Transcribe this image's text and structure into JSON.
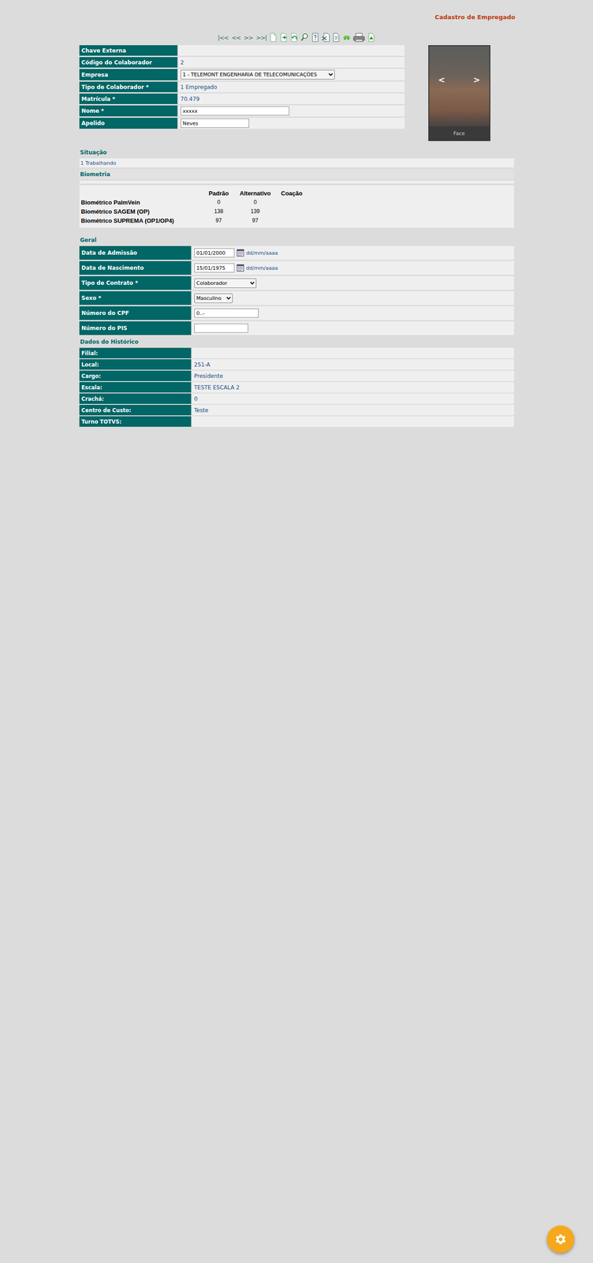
{
  "header": {
    "title": "Cadastro de Empregado"
  },
  "toolbar": {
    "nav": [
      "|<<",
      "<<",
      ">>",
      ">>|"
    ]
  },
  "identity": {
    "fields": [
      {
        "label": "Chave Externa",
        "kind": "text",
        "value": ""
      },
      {
        "label": "Código do Colaborador",
        "kind": "text",
        "value": "2"
      },
      {
        "label": "Empresa",
        "kind": "select",
        "value": "1 - TELEMONT ENGENHARIA DE TELECOMUNICAÇÕES"
      },
      {
        "label": "Tipo de Colaborador *",
        "kind": "text",
        "value": "1 Empregado"
      },
      {
        "label": "Matrícula *",
        "kind": "text",
        "value": "70.479"
      },
      {
        "label": "Nome *",
        "kind": "input",
        "value": "xxxxx"
      },
      {
        "label": "Apelido",
        "kind": "input",
        "value": "Neves"
      }
    ]
  },
  "photo": {
    "prev": "<",
    "next": ">",
    "caption": "Face"
  },
  "situacao": {
    "title": "Situação",
    "value": "1 Trabalhando"
  },
  "biometria": {
    "title": "Biometria",
    "columns": [
      "Padrão",
      "Alternativo",
      "Coação"
    ],
    "rows": [
      {
        "label": "Biométrico PalmVein",
        "values": [
          "0",
          "0",
          ""
        ]
      },
      {
        "label": "Biométrico SAGEM (OP)",
        "values": [
          "138",
          "139",
          ""
        ]
      },
      {
        "label": "Biométrico SUPREMA (OP1/OP4)",
        "values": [
          "97",
          "97",
          ""
        ]
      }
    ]
  },
  "geral": {
    "title": "Geral",
    "fields": [
      {
        "label": "Data de Admissão",
        "kind": "date",
        "value": "01/01/2000",
        "hint": "dd/mm/aaaa"
      },
      {
        "label": "Data de Nascimento",
        "kind": "date",
        "value": "15/01/1975",
        "hint": "dd/mm/aaaa"
      },
      {
        "label": "Tipo de Contrato *",
        "kind": "select",
        "value": "Colaborador",
        "hint": ""
      },
      {
        "label": "Sexo *",
        "kind": "select",
        "value": "Masculino",
        "hint": ""
      },
      {
        "label": "Número do CPF",
        "kind": "input",
        "value": "0..-",
        "hint": ""
      },
      {
        "label": "Número do PIS",
        "kind": "input",
        "value": "",
        "hint": ""
      }
    ]
  },
  "historico": {
    "title": "Dados do Histórico",
    "fields": [
      {
        "label": "Filial:",
        "value": ""
      },
      {
        "label": "Local:",
        "value": "251-A"
      },
      {
        "label": "Cargo:",
        "value": "Presidente"
      },
      {
        "label": "Escala:",
        "value": "TESTE ESCALA 2"
      },
      {
        "label": "Crachá:",
        "value": "0"
      },
      {
        "label": "Centro de Custo:",
        "value": "Teste"
      },
      {
        "label": "Turno TOTVS:",
        "value": ""
      }
    ]
  }
}
